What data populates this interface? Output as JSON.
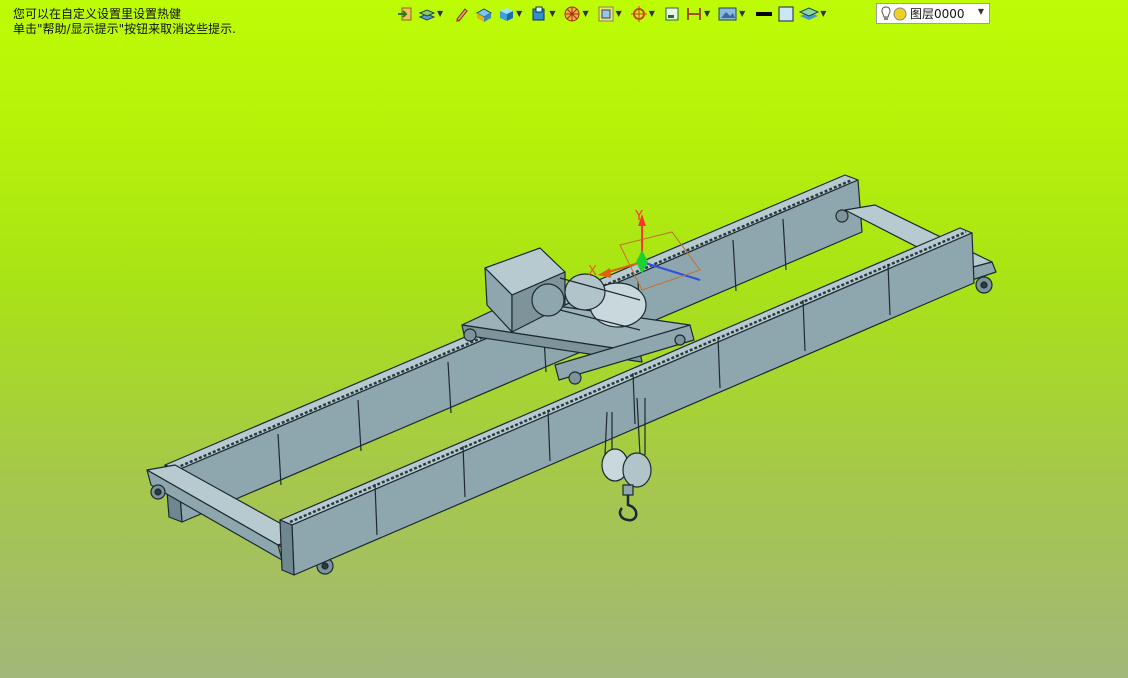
{
  "hint": {
    "line1": "您可以在自定义设置里设置热健",
    "line2": "单击\"帮助/显示提示\"按钮来取消这些提示."
  },
  "toolbar": {
    "icons": [
      "exit-icon",
      "layer-manager-icon",
      "pen-icon",
      "shaded-view-icon",
      "cube-view-icon",
      "cube-dropdown-icon",
      "render-mode-icon",
      "frame-icon",
      "target-icon",
      "box-icon",
      "dimension-icon",
      "picture-icon",
      "line-style-icon",
      "color-fill-icon",
      "layers-icon"
    ]
  },
  "layer": {
    "name": "图层0000"
  },
  "axes": {
    "x_label": "X",
    "y_label": "Y"
  },
  "colors": {
    "background_top": "#bdfc05",
    "background_bottom": "#a2b77a",
    "model_fill": "#8ea6ad",
    "model_edge": "#1c2a30",
    "axis_x": "#e06010",
    "axis_y": "#ff3030",
    "axis_z": "#3050e0"
  }
}
